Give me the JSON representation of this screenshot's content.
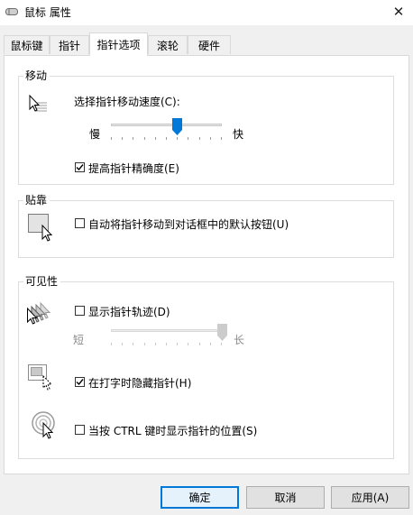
{
  "window": {
    "title": "鼠标 属性",
    "close_glyph": "✕"
  },
  "tabs": [
    {
      "label": "鼠标键"
    },
    {
      "label": "指针"
    },
    {
      "label": "指针选项",
      "active": true
    },
    {
      "label": "滚轮"
    },
    {
      "label": "硬件"
    }
  ],
  "motion": {
    "title": "移动",
    "speed_label": "选择指针移动速度(C):",
    "slow_label": "慢",
    "fast_label": "快",
    "speed_value": 0.6,
    "enhance_precision": {
      "label": "提高指针精确度(E)",
      "checked": true
    }
  },
  "snap": {
    "title": "贴靠",
    "snap_to_default": {
      "label": "自动将指针移动到对话框中的默认按钮(U)",
      "checked": false
    }
  },
  "visibility": {
    "title": "可见性",
    "trails": {
      "label": "显示指针轨迹(D)",
      "checked": false
    },
    "short_label": "短",
    "long_label": "长",
    "trail_length": 1.0,
    "hide_typing": {
      "label": "在打字时隐藏指针(H)",
      "checked": true
    },
    "show_location": {
      "label": "当按 CTRL 键时显示指针的位置(S)",
      "checked": false
    }
  },
  "buttons": {
    "ok": "确定",
    "cancel": "取消",
    "apply": "应用(A)"
  },
  "colors": {
    "accent": "#0078d7",
    "window_bg": "#f0f0f0",
    "panel_bg": "#ffffff"
  },
  "icons": {
    "title": "mouse-icon",
    "motion": "pointer-speed-icon",
    "snap": "snap-to-button-icon",
    "trails": "pointer-trails-icon",
    "hide": "hide-while-typing-icon",
    "location": "pointer-location-icon"
  }
}
